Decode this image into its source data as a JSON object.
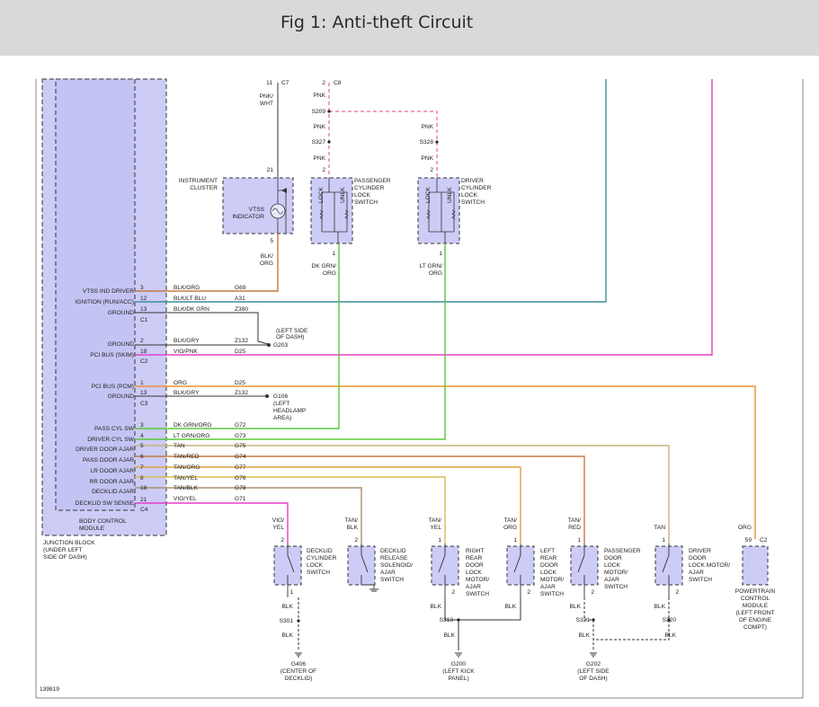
{
  "header": {
    "title": "Fig 1: Anti-theft Circuit"
  },
  "bcm": {
    "pins": [
      {
        "name": "VTSS IND DRIVER",
        "pin": "3",
        "color": "BLK/ORG",
        "circuit": "G69"
      },
      {
        "name": "IGNITION (RUN/ACC)",
        "pin": "12",
        "color": "BLK/LT BLU",
        "circuit": "A31"
      },
      {
        "name": "GROUND",
        "pin": "13",
        "color": "BLK/DK GRN",
        "circuit": "Z380"
      },
      {
        "name": "GROUND",
        "pin": "2",
        "color": "BLK/GRY",
        "circuit": "Z132"
      },
      {
        "name": "PCI BUS (SKIM)",
        "pin": "18",
        "color": "VIO/PNK",
        "circuit": "D25"
      },
      {
        "name": "PCI BUS (PCM)",
        "pin": "1",
        "color": "ORG",
        "circuit": "D25"
      },
      {
        "name": "GROUND",
        "pin": "13",
        "color": "BLK/GRY",
        "circuit": "Z132"
      },
      {
        "name": "PASS CYL SW",
        "pin": "3",
        "color": "DK GRN/ORG",
        "circuit": "G72"
      },
      {
        "name": "DRIVER CYL SW",
        "pin": "4",
        "color": "LT GRN/ORG",
        "circuit": "G73"
      },
      {
        "name": "DRIVER DOOR AJAR",
        "pin": "5",
        "color": "TAN",
        "circuit": "G75"
      },
      {
        "name": "PASS DOOR AJAR",
        "pin": "6",
        "color": "TAN/RED",
        "circuit": "G74"
      },
      {
        "name": "LR DOOR AJAR",
        "pin": "7",
        "color": "TAN/ORG",
        "circuit": "G77"
      },
      {
        "name": "RR DOOR AJAR",
        "pin": "8",
        "color": "TAN/YEL",
        "circuit": "G76"
      },
      {
        "name": "DECKLID AJAR",
        "pin": "18",
        "color": "TAN/BLK",
        "circuit": "G78"
      },
      {
        "name": "DECKLID SW SENSE",
        "pin": "21",
        "color": "VIO/YEL",
        "circuit": "G71"
      }
    ],
    "connectors": [
      "C1",
      "C2",
      "C3",
      "C4"
    ],
    "module_label": [
      "BODY CONTROL",
      "MODULE"
    ],
    "junction_label": [
      "JUNCTION BLOCK",
      "(UNDER LEFT",
      "SIDE OF DASH)"
    ]
  },
  "grounds_left": {
    "g203": {
      "label": "G203",
      "note": [
        "(LEFT SIDE",
        "OF DASH)"
      ]
    },
    "g106": {
      "label": "G106",
      "note": [
        "(LEFT",
        "HEADLAMP",
        "AREA)"
      ]
    }
  },
  "instrument_cluster": {
    "label": [
      "INSTRUMENT",
      "CLUSTER"
    ],
    "indicator": [
      "VTSS",
      "INDICATOR"
    ],
    "pin_top": "21",
    "pin_bottom": "5",
    "top_wire": [
      "PNK/",
      "WHT"
    ],
    "top_conn_pin": "11",
    "top_conn": "C7",
    "bottom_wire": [
      "BLK/",
      "ORG"
    ]
  },
  "pass_cyl": {
    "label": [
      "PASSENGER",
      "CYLINDER",
      "LOCK",
      "SWITCH"
    ],
    "pin_top": "2",
    "pin_bottom": "1",
    "lock": "LOCK",
    "unlk": "UNLK",
    "wire_out": [
      "DK GRN/",
      "ORG"
    ]
  },
  "driver_cyl": {
    "label": [
      "DRIVER",
      "CYLINDER",
      "LOCK",
      "SWITCH"
    ],
    "pin_top": "2",
    "pin_bottom": "1",
    "lock": "LOCK",
    "unlk": "UNLK",
    "wire_out": [
      "LT GRN/",
      "ORG"
    ]
  },
  "pnk_feed": {
    "conn_pin": "2",
    "conn": "C8",
    "splices": [
      "S209",
      "S327",
      "S328"
    ],
    "wire": "PNK"
  },
  "bottom_components": [
    {
      "wire": [
        "VIO/",
        "YEL"
      ],
      "label": [
        "DECKLID",
        "CYLINDER",
        "LOCK",
        "SWITCH"
      ],
      "pin_top": "2",
      "pin_bottom": "1"
    },
    {
      "wire": [
        "TAN/",
        "BLK"
      ],
      "label": [
        "DECKLID",
        "RELEASE",
        "SOLENOID/",
        "AJAR",
        "SWITCH"
      ],
      "pin_top": "2"
    },
    {
      "wire": [
        "TAN/",
        "YEL"
      ],
      "label": [
        "RIGHT",
        "REAR",
        "DOOR",
        "LOCK",
        "MOTOR/",
        "AJAR",
        "SWITCH"
      ],
      "pin_top": "1",
      "pin_bottom": "2"
    },
    {
      "wire": [
        "TAN/",
        "ORG"
      ],
      "label": [
        "LEFT",
        "REAR",
        "DOOR",
        "LOCK",
        "MOTOR/",
        "AJAR",
        "SWITCH"
      ],
      "pin_top": "1",
      "pin_bottom": "2"
    },
    {
      "wire": [
        "TAN/",
        "RED"
      ],
      "label": [
        "PASSENGER",
        "DOOR",
        "LOCK",
        "MOTOR/",
        "AJAR",
        "SWITCH"
      ],
      "pin_top": "1",
      "pin_bottom": "2"
    },
    {
      "wire": [
        "TAN"
      ],
      "label": [
        "DRIVER",
        "DOOR",
        "LOCK MOTOR/",
        "AJAR",
        "SWITCH"
      ],
      "pin_top": "1",
      "pin_bottom": "2"
    }
  ],
  "pcm": {
    "wire": "ORG",
    "pin": "59",
    "conn": "C2",
    "label": [
      "POWERTRAIN",
      "CONTROL",
      "MODULE",
      "(LEFT FRONT",
      "OF ENGINE",
      "COMPT)"
    ]
  },
  "ground_paths": {
    "wire": "BLK",
    "splices": [
      "S301",
      "S313",
      "S321",
      "S320"
    ],
    "g406": {
      "label": "G406",
      "note": [
        "(CENTER OF",
        "DECKLID)"
      ]
    },
    "g200": {
      "label": "G200",
      "note": [
        "(LEFT KICK",
        "PANEL)"
      ]
    },
    "g202": {
      "label": "G202",
      "note": [
        "(LEFT SIDE",
        "OF DASH)"
      ]
    }
  },
  "figure_id": "139819",
  "colors": {
    "teal": "#3a8f9a",
    "magenta": "#e83cc8",
    "orange": "#f09030",
    "green": "#58c83a",
    "brown_orange": "#c87840",
    "tan": "#c8b47a",
    "bcm_fill": "#ccccf6",
    "comp_fill": "#ccccf6"
  }
}
